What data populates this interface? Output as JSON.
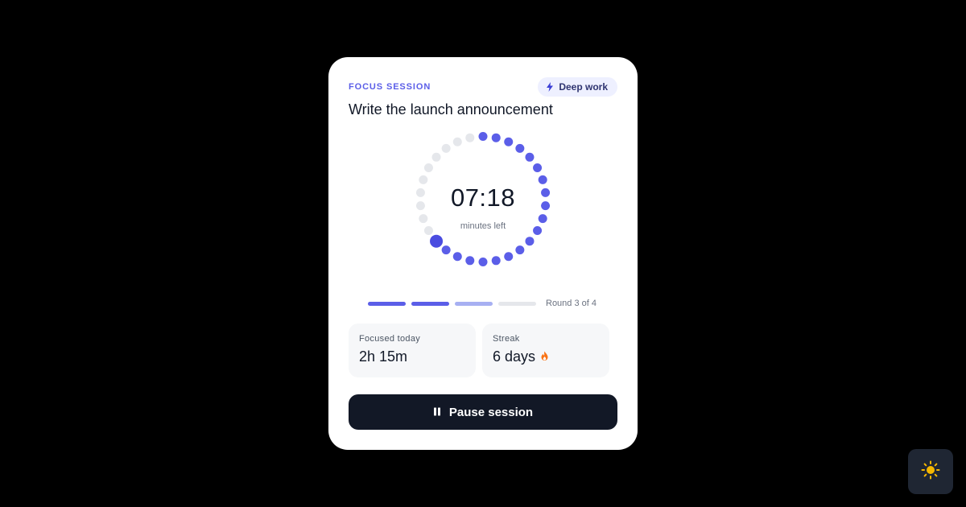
{
  "session": {
    "eyebrow": "FOCUS SESSION",
    "mode_chip": {
      "label": "Deep work",
      "icon": "bolt-icon"
    },
    "title": "Write the launch announcement",
    "timer": {
      "time": "07:18",
      "caption": "minutes left",
      "total_dots": 30,
      "remaining_dots": 20
    },
    "rounds": {
      "states": [
        "done",
        "done",
        "current",
        "pending"
      ],
      "label": "Round 3 of 4"
    },
    "stats": [
      {
        "label": "Focused today",
        "value": "2h 15m",
        "icon": ""
      },
      {
        "label": "Streak",
        "value": "6 days",
        "icon": "flame-icon"
      }
    ],
    "action_button": {
      "label": "Pause session",
      "icon": "pause-icon"
    }
  },
  "theme_toggle": {
    "icon": "sun-icon"
  },
  "colors": {
    "accent": "#5b5ee8",
    "accent_soft": "#a7b0f2",
    "inactive": "#e5e7eb",
    "button_bg": "#121826",
    "flame": "#f97316",
    "sun": "#f5b700"
  }
}
